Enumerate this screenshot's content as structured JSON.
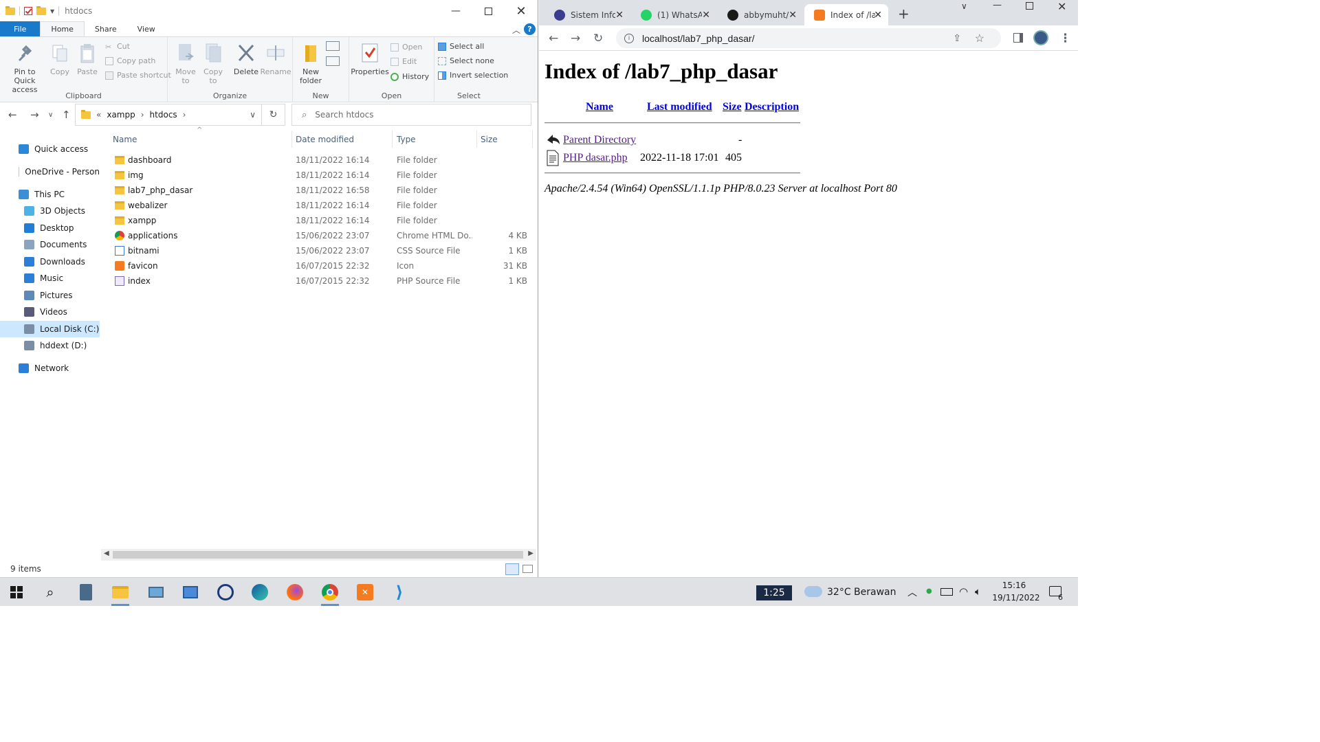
{
  "explorer": {
    "title": "htdocs",
    "ribbon_tabs": [
      "File",
      "Home",
      "Share",
      "View"
    ],
    "clipboard": {
      "group_label": "Clipboard",
      "pin_label": "Pin to Quick access",
      "copy_label": "Copy",
      "paste_label": "Paste",
      "cut_label": "Cut",
      "copy_path_label": "Copy path",
      "paste_shortcut_label": "Paste shortcut"
    },
    "organize": {
      "group_label": "Organize",
      "move_to_label": "Move to",
      "copy_to_label": "Copy to",
      "delete_label": "Delete",
      "rename_label": "Rename"
    },
    "new": {
      "group_label": "New",
      "new_folder_label": "New folder"
    },
    "open": {
      "group_label": "Open",
      "properties_label": "Properties",
      "open_label": "Open",
      "edit_label": "Edit",
      "history_label": "History"
    },
    "select": {
      "group_label": "Select",
      "select_all_label": "Select all",
      "select_none_label": "Select none",
      "invert_label": "Invert selection"
    },
    "address": {
      "overflow": "«",
      "crumbs": [
        "xampp",
        "htdocs"
      ],
      "search_placeholder": "Search htdocs"
    },
    "nav": [
      {
        "label": "Quick access",
        "icon": "star-icon",
        "color": "#2b88d8"
      },
      {
        "label": "OneDrive - Person",
        "icon": "folder-icon",
        "color": "#f5c542"
      },
      {
        "label": "This PC",
        "icon": "computer-icon",
        "color": "#3a8fd6"
      },
      {
        "label": "3D Objects",
        "icon": "cube-icon",
        "color": "#4db3e6"
      },
      {
        "label": "Desktop",
        "icon": "desktop-icon",
        "color": "#1f7fd8"
      },
      {
        "label": "Documents",
        "icon": "document-icon",
        "color": "#8aa4c2"
      },
      {
        "label": "Downloads",
        "icon": "download-icon",
        "color": "#2b7fd8"
      },
      {
        "label": "Music",
        "icon": "music-icon",
        "color": "#2b7fd8"
      },
      {
        "label": "Pictures",
        "icon": "picture-icon",
        "color": "#5d8ab8"
      },
      {
        "label": "Videos",
        "icon": "video-icon",
        "color": "#5a5a7a"
      },
      {
        "label": "Local Disk (C:)",
        "icon": "disk-icon",
        "color": "#7a8ea6"
      },
      {
        "label": "hddext (D:)",
        "icon": "disk-icon",
        "color": "#7a8ea6"
      },
      {
        "label": "Network",
        "icon": "network-icon",
        "color": "#2b7fd8"
      }
    ],
    "columns": {
      "name": "Name",
      "date": "Date modified",
      "type": "Type",
      "size": "Size"
    },
    "files": [
      {
        "name": "dashboard",
        "date": "18/11/2022 16:14",
        "type": "File folder",
        "size": "",
        "icon": "folder"
      },
      {
        "name": "img",
        "date": "18/11/2022 16:14",
        "type": "File folder",
        "size": "",
        "icon": "folder"
      },
      {
        "name": "lab7_php_dasar",
        "date": "18/11/2022 16:58",
        "type": "File folder",
        "size": "",
        "icon": "folder"
      },
      {
        "name": "webalizer",
        "date": "18/11/2022 16:14",
        "type": "File folder",
        "size": "",
        "icon": "folder"
      },
      {
        "name": "xampp",
        "date": "18/11/2022 16:14",
        "type": "File folder",
        "size": "",
        "icon": "folder"
      },
      {
        "name": "applications",
        "date": "15/06/2022 23:07",
        "type": "Chrome HTML Do...",
        "size": "4 KB",
        "icon": "chrome"
      },
      {
        "name": "bitnami",
        "date": "15/06/2022 23:07",
        "type": "CSS Source File",
        "size": "1 KB",
        "icon": "css"
      },
      {
        "name": "favicon",
        "date": "16/07/2015 22:32",
        "type": "Icon",
        "size": "31 KB",
        "icon": "xampp"
      },
      {
        "name": "index",
        "date": "16/07/2015 22:32",
        "type": "PHP Source File",
        "size": "1 KB",
        "icon": "php"
      }
    ],
    "status": "9 items"
  },
  "chrome": {
    "tabs": [
      {
        "title": "Sistem Info",
        "icon": "sistem-icon",
        "color": "#3b3b8f"
      },
      {
        "title": "(1) WhatsA",
        "icon": "whatsapp-icon",
        "color": "#25d366"
      },
      {
        "title": "abbymuht/",
        "icon": "github-icon",
        "color": "#1a1a1a"
      },
      {
        "title": "Index of /la",
        "icon": "xampp-icon",
        "color": "#f47b20"
      }
    ],
    "url": "localhost/lab7_php_dasar/",
    "page": {
      "heading": "Index of /lab7_php_dasar",
      "col_name": "Name",
      "col_modified": "Last modified",
      "col_size": "Size",
      "col_desc": "Description",
      "parent_label": "Parent Directory",
      "parent_size": "-",
      "entry_name": "PHP dasar.php",
      "entry_modified": "2022-11-18 17:01",
      "entry_size": "405",
      "server_line": "Apache/2.4.54 (Win64) OpenSSL/1.1.1p PHP/8.0.23 Server at localhost Port 80"
    }
  },
  "taskbar": {
    "clock_widget": "1:25",
    "weather": "32°C  Berawan",
    "time": "15:16",
    "date": "19/11/2022",
    "notif_count": "6"
  }
}
